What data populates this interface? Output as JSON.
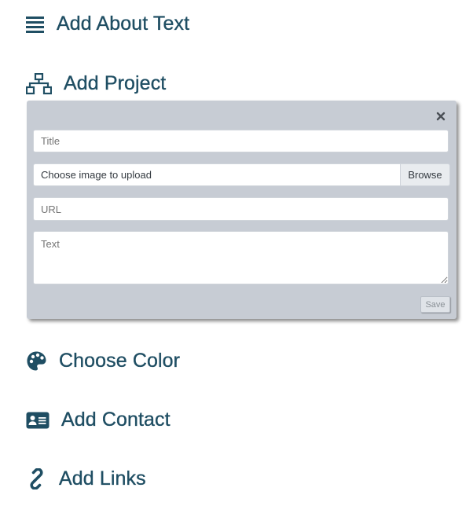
{
  "sections": {
    "about": {
      "label": "Add About Text",
      "icon": "align-justify-icon"
    },
    "project": {
      "label": "Add Project",
      "icon": "sitemap-icon"
    },
    "color": {
      "label": "Choose Color",
      "icon": "palette-icon"
    },
    "contact": {
      "label": "Add Contact",
      "icon": "address-card-icon"
    },
    "links": {
      "label": "Add Links",
      "icon": "link-icon"
    }
  },
  "project_form": {
    "title_placeholder": "Title",
    "file_label": "Choose image to upload",
    "browse_label": "Browse",
    "url_placeholder": "URL",
    "text_placeholder": "Text",
    "save_label": "Save",
    "close_icon": "close-icon"
  },
  "colors": {
    "heading": "#1f4e63",
    "panel_bg": "#c7ccd4"
  }
}
